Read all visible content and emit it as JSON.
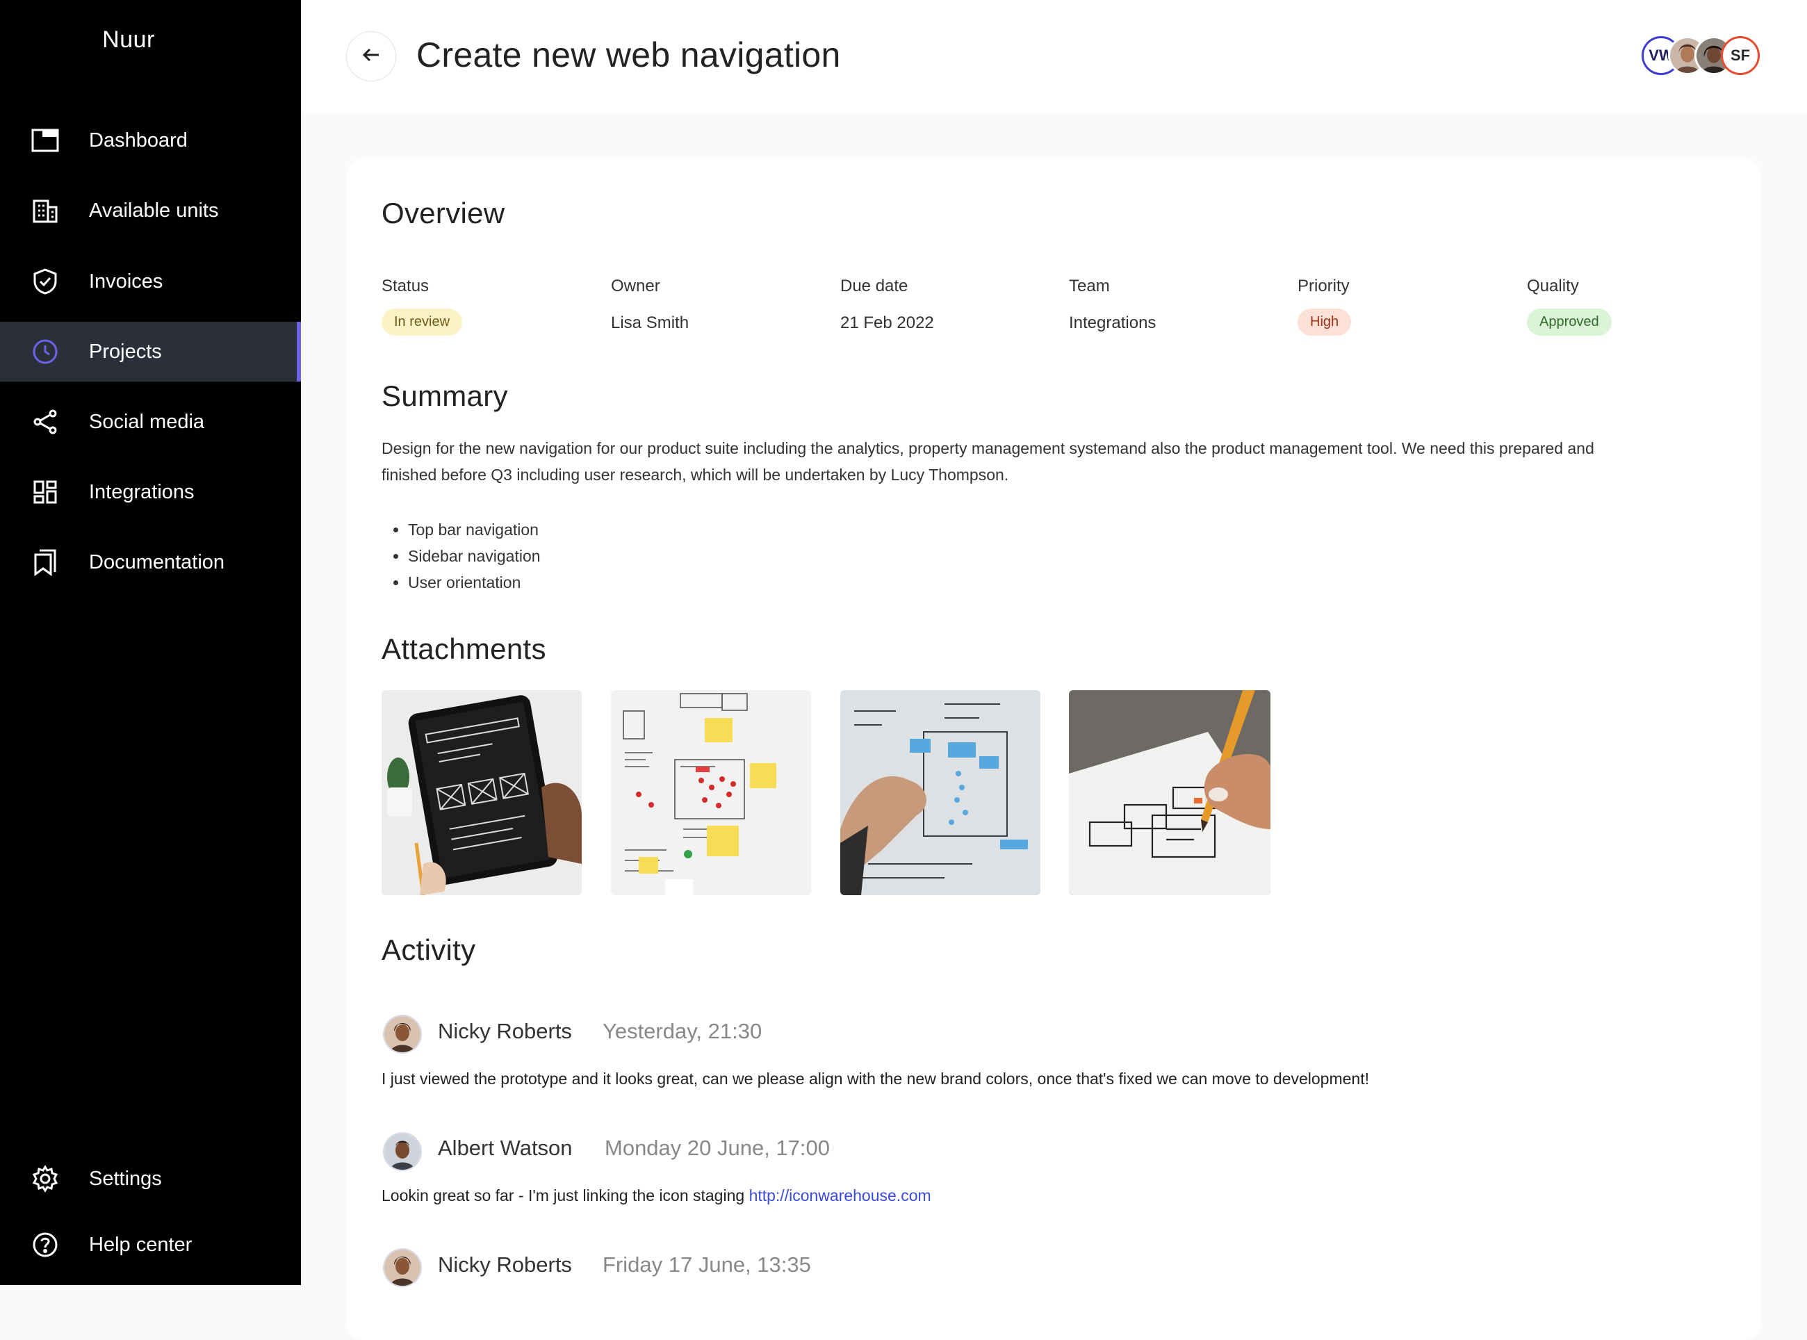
{
  "app": {
    "brand": "Nuur"
  },
  "sidebar": {
    "items": [
      {
        "label": "Dashboard",
        "icon": "dashboard-icon"
      },
      {
        "label": "Available units",
        "icon": "building-icon"
      },
      {
        "label": "Invoices",
        "icon": "shield-icon"
      },
      {
        "label": "Projects",
        "icon": "clock-icon",
        "active": true
      },
      {
        "label": "Social media",
        "icon": "share-icon"
      },
      {
        "label": "Integrations",
        "icon": "grid-icon"
      },
      {
        "label": "Documentation",
        "icon": "bookmark-icon"
      }
    ],
    "bottom": [
      {
        "label": "Settings",
        "icon": "gear-icon"
      },
      {
        "label": "Help center",
        "icon": "help-icon"
      }
    ]
  },
  "header": {
    "title": "Create new web navigation",
    "avatars": [
      {
        "initials": "VW",
        "ring": "#3b3ccf"
      },
      {
        "initials": "",
        "photo": true
      },
      {
        "initials": "",
        "photo": true
      },
      {
        "initials": "SF",
        "ring": "#e94b2b"
      }
    ]
  },
  "overview": {
    "title": "Overview",
    "status": {
      "label": "Status",
      "value": "In review"
    },
    "owner": {
      "label": "Owner",
      "value": "Lisa Smith"
    },
    "due": {
      "label": "Due date",
      "value": "21 Feb 2022"
    },
    "team": {
      "label": "Team",
      "value": "Integrations"
    },
    "priority": {
      "label": "Priority",
      "value": "High"
    },
    "quality": {
      "label": "Quality",
      "value": "Approved"
    }
  },
  "summary": {
    "title": "Summary",
    "text": "Design for the new navigation for our product suite including the analytics, property management systemand also the product management tool. We need this prepared and finished before Q3 including user research, which will be undertaken by Lucy Thompson.",
    "bullets": [
      "Top bar navigation",
      "Sidebar navigation",
      "User orientation"
    ]
  },
  "attachments": {
    "title": "Attachments",
    "items": [
      {
        "kind": "tablet-wireframe"
      },
      {
        "kind": "whiteboard-sticky-notes"
      },
      {
        "kind": "wall-wireframes"
      },
      {
        "kind": "pen-sketch"
      }
    ]
  },
  "activity": {
    "title": "Activity",
    "entries": [
      {
        "name": "Nicky Roberts",
        "time": "Yesterday, 21:30",
        "text": "I just viewed the prototype and it looks great, can we please align with the new brand colors, once that's fixed we can move to development!"
      },
      {
        "name": "Albert Watson",
        "time": "Monday 20 June, 17:00",
        "text": "Lookin great so far - I'm just linking the icon staging ",
        "link": "http://iconwarehouse.com"
      },
      {
        "name": "Nicky Roberts",
        "time": "Friday 17 June, 13:35",
        "text": ""
      }
    ]
  },
  "colors": {
    "accent": "#6d63e8",
    "sidebar_bg": "#000000",
    "active_bg": "#2b2f39",
    "link": "#3b4ae0",
    "badge_review_bg": "#fbf3c7",
    "badge_high_bg": "#fde0d6",
    "badge_approved_bg": "#d9f5d5"
  }
}
